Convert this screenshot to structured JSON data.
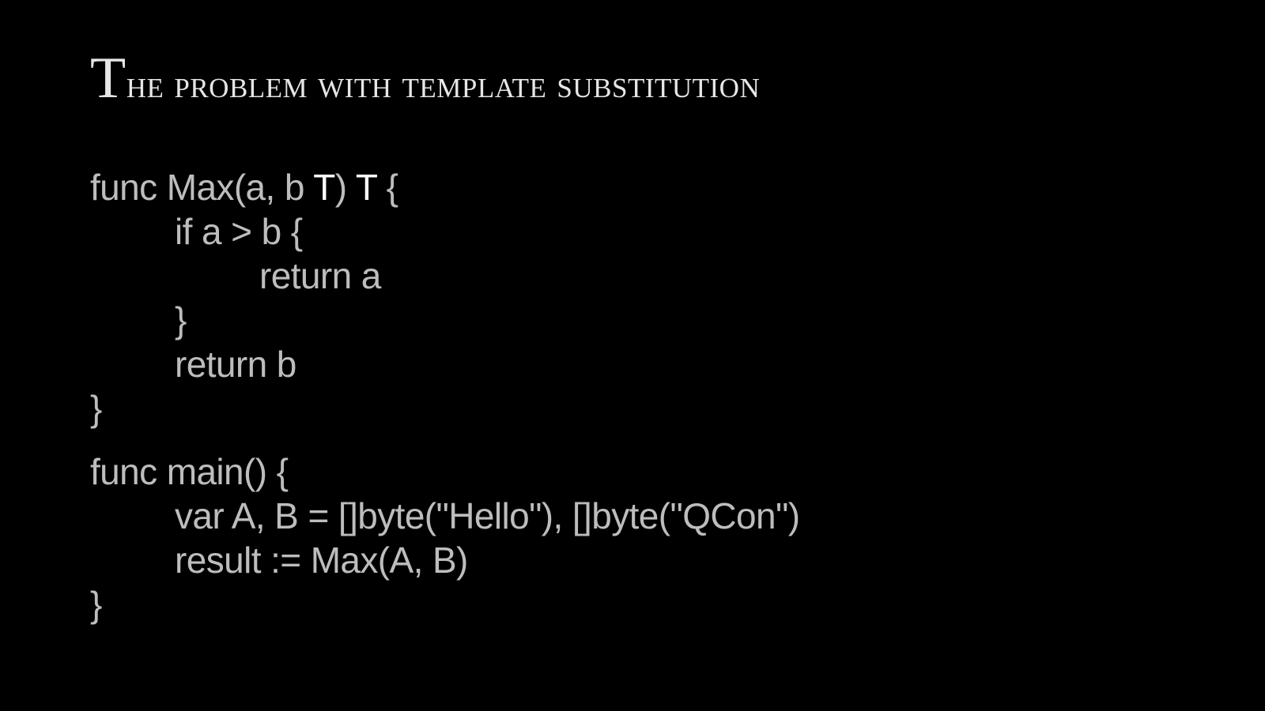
{
  "slide": {
    "title_first_letter": "T",
    "title_rest": "he problem with template substitution",
    "colors": {
      "background": "#000000",
      "title": "#e6e6e6",
      "code": "#bdbdbd",
      "highlight": "#ffffff"
    },
    "code_block_1": {
      "line1_a": "func Max(a, b ",
      "line1_t1": "T",
      "line1_b": ") ",
      "line1_t2": "T",
      "line1_c": " {",
      "line2": "if a > b {",
      "line3": "return a",
      "line4": "}",
      "line5": "return b",
      "line6": "}"
    },
    "code_block_2": {
      "line1": "func main() {",
      "line2": "var A, B = []byte(\"Hello\"), []byte(\"QCon\")",
      "line3": "result := Max(A, B)",
      "line4": "}"
    }
  }
}
